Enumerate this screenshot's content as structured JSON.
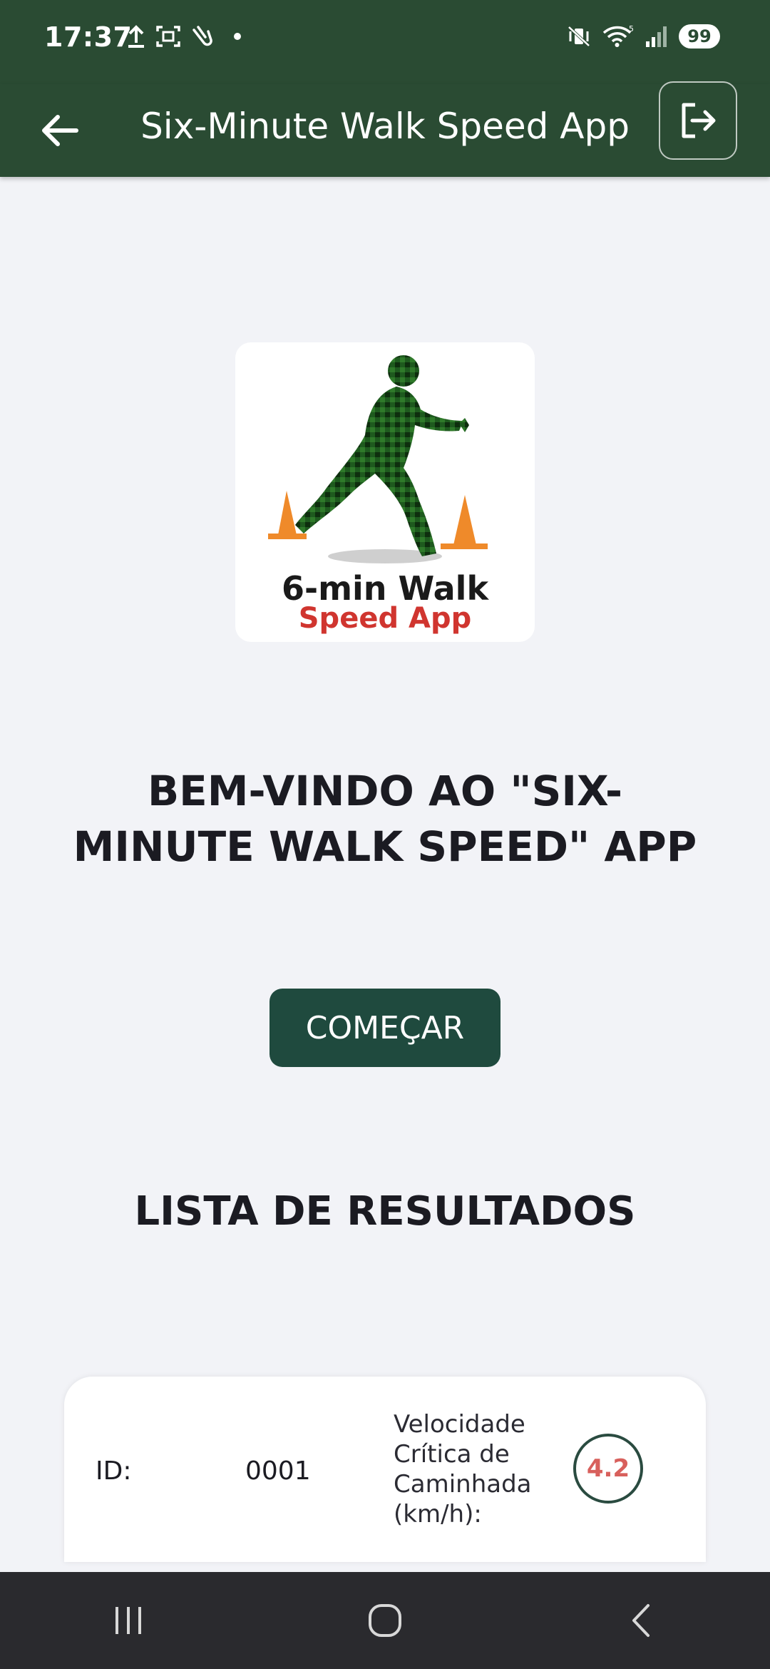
{
  "status_bar": {
    "time": "17:37",
    "battery": "99",
    "icons_left": [
      "upload-icon",
      "screenshot-icon",
      "gesture-icon",
      "notification-dot"
    ],
    "icons_right": [
      "mute-vibrate-icon",
      "wifi-icon",
      "signal-icon",
      "battery-indicator"
    ]
  },
  "app_bar": {
    "title": "Six-Minute Walk Speed App",
    "color": "#2a4b33"
  },
  "logo": {
    "title": "6-min Walk",
    "subtitle": "Speed App",
    "subtitle_color": "#d0352f"
  },
  "welcome": {
    "heading": "BEM-VINDO AO \"SIX-MINUTE WALK SPEED\" APP"
  },
  "start_button": {
    "label": "COMEÇAR",
    "color": "#1f4a3e"
  },
  "results": {
    "title": "LISTA DE RESULTADOS",
    "items": [
      {
        "id_label": "ID:",
        "id_value": "0001",
        "speed_label": "Velocidade Crítica de Caminhada (km/h):",
        "speed_value": "4.2"
      }
    ]
  }
}
